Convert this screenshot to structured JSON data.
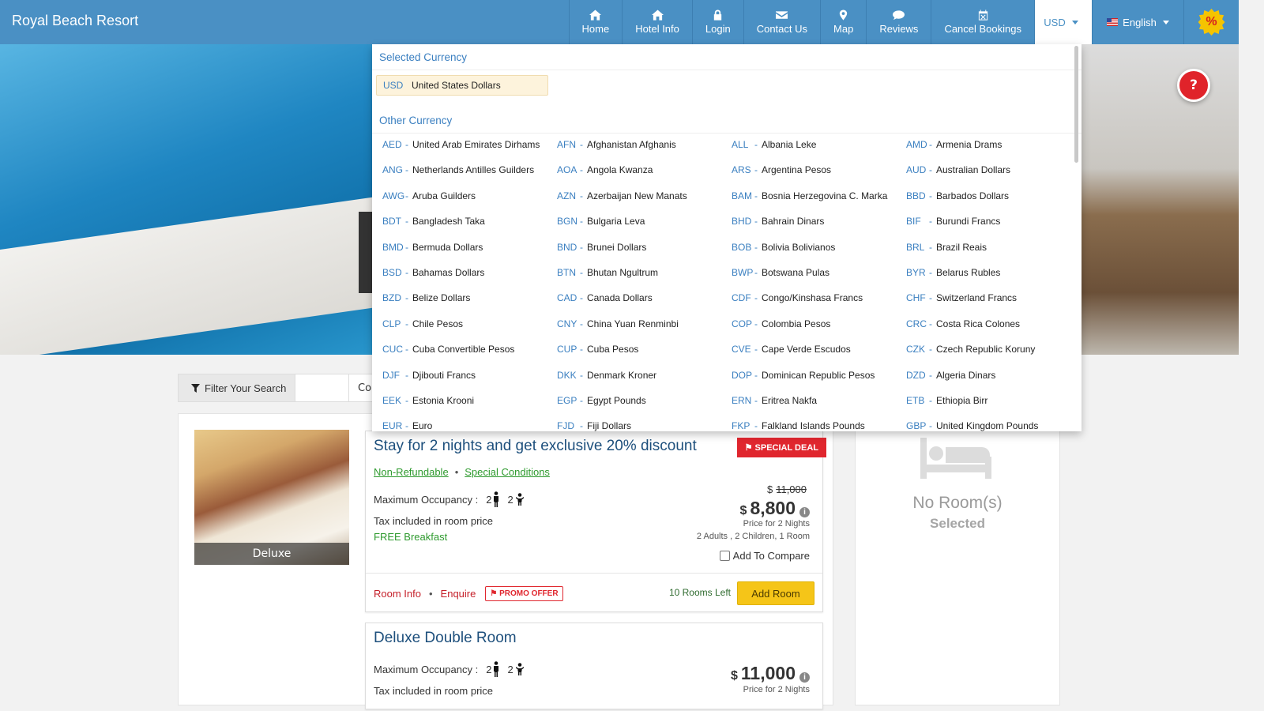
{
  "brand": "Royal Beach Resort",
  "nav": {
    "items": [
      {
        "label": "Home",
        "icon": "home-icon"
      },
      {
        "label": "Hotel Info",
        "icon": "hotel-icon"
      },
      {
        "label": "Login",
        "icon": "lock-icon"
      },
      {
        "label": "Contact Us",
        "icon": "envelope-icon"
      },
      {
        "label": "Map",
        "icon": "map-marker-icon"
      },
      {
        "label": "Reviews",
        "icon": "comment-icon"
      },
      {
        "label": "Cancel Bookings",
        "icon": "calendar-x-icon"
      }
    ],
    "currency": "USD",
    "language": "English",
    "promo_symbol": "%"
  },
  "help_button": "?",
  "currency_dropdown": {
    "selected_heading": "Selected Currency",
    "selected": {
      "code": "USD",
      "name": "United States Dollars"
    },
    "other_heading": "Other Currency",
    "currencies": [
      {
        "code": "AED",
        "name": "United Arab Emirates Dirhams"
      },
      {
        "code": "AFN",
        "name": "Afghanistan Afghanis"
      },
      {
        "code": "ALL",
        "name": "Albania Leke"
      },
      {
        "code": "AMD",
        "name": "Armenia Drams"
      },
      {
        "code": "ANG",
        "name": "Netherlands Antilles Guilders"
      },
      {
        "code": "AOA",
        "name": "Angola Kwanza"
      },
      {
        "code": "ARS",
        "name": "Argentina Pesos"
      },
      {
        "code": "AUD",
        "name": "Australian Dollars"
      },
      {
        "code": "AWG",
        "name": "Aruba Guilders"
      },
      {
        "code": "AZN",
        "name": "Azerbaijan New Manats"
      },
      {
        "code": "BAM",
        "name": "Bosnia Herzegovina C. Marka"
      },
      {
        "code": "BBD",
        "name": "Barbados Dollars"
      },
      {
        "code": "BDT",
        "name": "Bangladesh Taka"
      },
      {
        "code": "BGN",
        "name": "Bulgaria Leva"
      },
      {
        "code": "BHD",
        "name": "Bahrain Dinars"
      },
      {
        "code": "BIF",
        "name": "Burundi Francs"
      },
      {
        "code": "BMD",
        "name": "Bermuda Dollars"
      },
      {
        "code": "BND",
        "name": "Brunei Dollars"
      },
      {
        "code": "BOB",
        "name": "Bolivia Bolivianos"
      },
      {
        "code": "BRL",
        "name": "Brazil Reais"
      },
      {
        "code": "BSD",
        "name": "Bahamas Dollars"
      },
      {
        "code": "BTN",
        "name": "Bhutan Ngultrum"
      },
      {
        "code": "BWP",
        "name": "Botswana Pulas"
      },
      {
        "code": "BYR",
        "name": "Belarus Rubles"
      },
      {
        "code": "BZD",
        "name": "Belize Dollars"
      },
      {
        "code": "CAD",
        "name": "Canada Dollars"
      },
      {
        "code": "CDF",
        "name": "Congo/Kinshasa Francs"
      },
      {
        "code": "CHF",
        "name": "Switzerland Francs"
      },
      {
        "code": "CLP",
        "name": "Chile Pesos"
      },
      {
        "code": "CNY",
        "name": "China Yuan Renminbi"
      },
      {
        "code": "COP",
        "name": "Colombia Pesos"
      },
      {
        "code": "CRC",
        "name": "Costa Rica Colones"
      },
      {
        "code": "CUC",
        "name": "Cuba Convertible Pesos"
      },
      {
        "code": "CUP",
        "name": "Cuba Pesos"
      },
      {
        "code": "CVE",
        "name": "Cape Verde Escudos"
      },
      {
        "code": "CZK",
        "name": "Czech Republic Koruny"
      },
      {
        "code": "DJF",
        "name": "Djibouti Francs"
      },
      {
        "code": "DKK",
        "name": "Denmark Kroner"
      },
      {
        "code": "DOP",
        "name": "Dominican Republic Pesos"
      },
      {
        "code": "DZD",
        "name": "Algeria Dinars"
      },
      {
        "code": "EEK",
        "name": "Estonia Krooni"
      },
      {
        "code": "EGP",
        "name": "Egypt Pounds"
      },
      {
        "code": "ERN",
        "name": "Eritrea Nakfa"
      },
      {
        "code": "ETB",
        "name": "Ethiopia Birr"
      },
      {
        "code": "EUR",
        "name": "Euro"
      },
      {
        "code": "FJD",
        "name": "Fiji Dollars"
      },
      {
        "code": "FKP",
        "name": "Falkland Islands Pounds"
      },
      {
        "code": "GBP",
        "name": "United Kingdom Pounds"
      }
    ]
  },
  "filter": {
    "label": "Filter Your Search",
    "sort_partial": "Co"
  },
  "room": {
    "thumb_caption": "Deluxe",
    "deal": {
      "title": "Stay for 2 nights and get exclusive 20% discount",
      "badge": "SPECIAL DEAL",
      "link1": "Non-Refundable",
      "link2": "Special Conditions",
      "occupancy_label": "Maximum Occupancy :",
      "adults": "2",
      "children": "2",
      "tax_note": "Tax included in room price",
      "breakfast": "FREE Breakfast",
      "old_currency": "$",
      "old_price": "11,000",
      "currency": "$",
      "price": "8,800",
      "price_note": "Price for 2 Nights",
      "guests_note": "2 Adults , 2 Children, 1 Room",
      "compare_label": "Add To Compare",
      "room_info": "Room Info",
      "enquire": "Enquire",
      "promo_tag": "PROMO OFFER",
      "rooms_left": "10 Rooms Left",
      "add_button": "Add Room"
    },
    "second": {
      "title": "Deluxe Double Room",
      "occupancy_label": "Maximum Occupancy :",
      "adults": "2",
      "children": "2",
      "tax_note": "Tax included in room price",
      "currency": "$",
      "price": "11,000",
      "price_note": "Price for 2 Nights"
    }
  },
  "side_panel": {
    "line1": "No Room(s)",
    "line2": "Selected"
  }
}
